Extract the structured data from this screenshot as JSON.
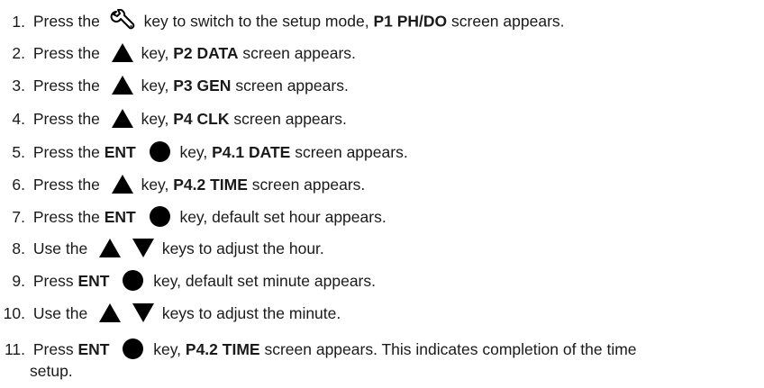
{
  "steps": [
    {
      "n": "1.",
      "pre": "Press the",
      "post": "key to switch to the setup mode,",
      "bold": "P1 PH/DO",
      "end": "screen appears."
    },
    {
      "n": "2.",
      "pre": "Press the",
      "post": "key,",
      "bold": "P2 DATA",
      "end": "screen appears."
    },
    {
      "n": "3.",
      "pre": "Press the",
      "post": "key,",
      "bold": "P3 GEN",
      "end": "screen appears."
    },
    {
      "n": "4.",
      "pre": "Press the",
      "post": "key,",
      "bold": "P4 CLK",
      "end": "screen appears."
    },
    {
      "n": "5.",
      "pre": "Press the",
      "key": "ENT",
      "post": "key,",
      "bold": "P4.1 DATE",
      "end": "screen appears."
    },
    {
      "n": "6.",
      "pre": "Press the",
      "post": "key,",
      "bold": "P4.2 TIME",
      "end": "screen appears."
    },
    {
      "n": "7.",
      "pre": "Press the",
      "key": "ENT",
      "post": "key, default set hour appears."
    },
    {
      "n": "8.",
      "pre": "Use the",
      "post": "keys to adjust the hour."
    },
    {
      "n": "9.",
      "pre": "Press",
      "key": "ENT",
      "post": "key, default set minute appears."
    },
    {
      "n": "10.",
      "pre": "Use the",
      "post": "keys to adjust the minute."
    },
    {
      "n": "11.",
      "pre": "Press",
      "key": "ENT",
      "post": "key,",
      "bold": "P4.2 TIME",
      "end": "screen appears. This indicates completion of the time",
      "cont": "setup."
    }
  ],
  "icons": {
    "wrench": "wrench-icon",
    "up": "up-arrow-key-icon",
    "down": "down-arrow-key-icon",
    "enter": "enter-key-dot-icon"
  }
}
